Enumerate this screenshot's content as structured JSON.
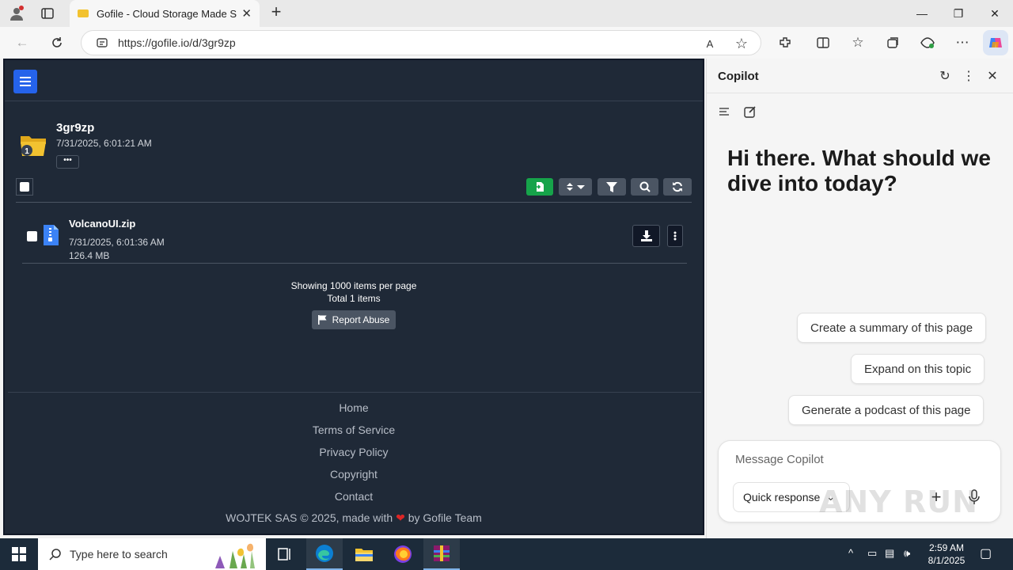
{
  "browser": {
    "tab_title": "Gofile - Cloud Storage Made Simp",
    "url": "https://gofile.io/d/3gr9zp"
  },
  "gofile": {
    "folder": {
      "name": "3gr9zp",
      "date": "7/31/2025, 6:01:21 AM",
      "badge_count": "1",
      "more_label": "•••"
    },
    "files": [
      {
        "name": "VolcanoUI.zip",
        "date": "7/31/2025, 6:01:36 AM",
        "size": "126.4 MB"
      }
    ],
    "pager": {
      "per_page": "Showing 1000 items per page",
      "total": "Total 1 items"
    },
    "report_label": "Report Abuse",
    "footer": {
      "links": [
        "Home",
        "Terms of Service",
        "Privacy Policy",
        "Copyright",
        "Contact"
      ],
      "copy_left": "WOJTEK SAS © 2025, made with",
      "copy_right": "by Gofile Team"
    }
  },
  "copilot": {
    "title": "Copilot",
    "greeting": "Hi there. What should we dive into today?",
    "suggestions": [
      "Create a summary of this page",
      "Expand on this topic",
      "Generate a podcast of this page"
    ],
    "message_placeholder": "Message Copilot",
    "mode_label": "Quick response",
    "watermark": "ANY RUN"
  },
  "taskbar": {
    "search_placeholder": "Type here to search",
    "time": "2:59 AM",
    "date": "8/1/2025"
  },
  "colors": {
    "page_bg": "#1f2937",
    "accent_blue": "#2563eb",
    "upload_green": "#16a34a",
    "folder_yellow": "#f2c230",
    "heart_red": "#dc2626"
  }
}
